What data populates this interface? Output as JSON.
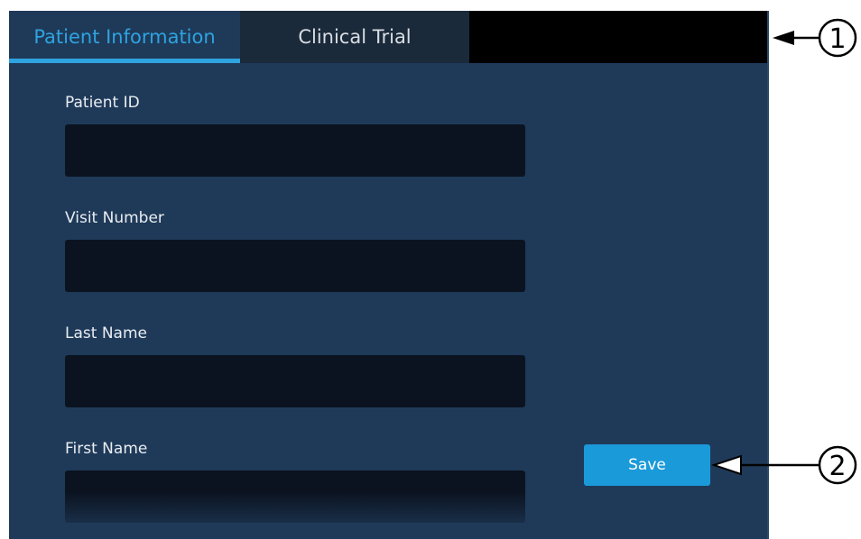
{
  "tabs": {
    "patient_information": "Patient Information",
    "clinical_trial": "Clinical Trial"
  },
  "fields": {
    "patient_id": {
      "label": "Patient ID",
      "value": ""
    },
    "visit_number": {
      "label": "Visit Number",
      "value": ""
    },
    "last_name": {
      "label": "Last Name",
      "value": ""
    },
    "first_name": {
      "label": "First Name",
      "value": ""
    }
  },
  "actions": {
    "save_label": "Save"
  },
  "callouts": {
    "one": "1",
    "two": "2"
  },
  "colors": {
    "panel_background": "#1f3a59",
    "input_background": "#0b1320",
    "active_tab_accent": "#2ea3e0",
    "inactive_tab_background": "#1a2a3b",
    "button_background": "#1a9ad9"
  },
  "icons": {
    "callout_arrow": "arrow-left-icon"
  }
}
